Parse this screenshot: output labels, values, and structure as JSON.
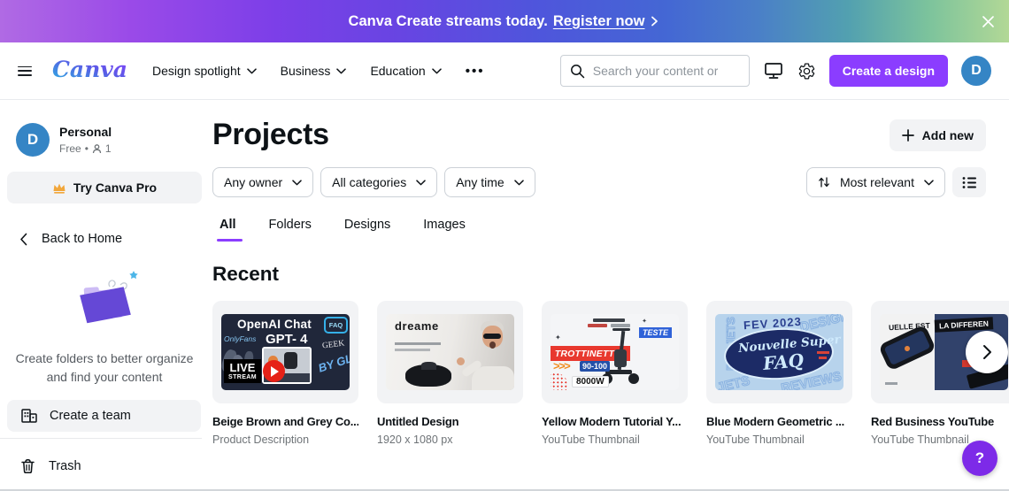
{
  "banner": {
    "message": "Canva Create streams today.",
    "cta": "Register now"
  },
  "header": {
    "logo": "Canva",
    "nav": [
      {
        "label": "Design spotlight"
      },
      {
        "label": "Business"
      },
      {
        "label": "Education"
      }
    ],
    "more": "•••",
    "search_placeholder": "Search your content or ",
    "create_button": "Create a design",
    "avatar_initial": "D"
  },
  "sidebar": {
    "avatar_initial": "D",
    "team_name": "Personal",
    "plan": "Free",
    "separator": "•",
    "members_count": "1",
    "try_pro": "Try Canva Pro",
    "back_home": "Back to Home",
    "empty_line1": "Create folders to better organize",
    "empty_line2": "and find your content",
    "create_team": "Create a team",
    "trash": "Trash"
  },
  "main": {
    "title": "Projects",
    "add_new": "Add new",
    "filters": [
      {
        "label": "Any owner"
      },
      {
        "label": "All categories"
      },
      {
        "label": "Any time"
      }
    ],
    "sort": "Most relevant",
    "tabs": [
      {
        "label": "All"
      },
      {
        "label": "Folders"
      },
      {
        "label": "Designs"
      },
      {
        "label": "Images"
      }
    ],
    "section_title": "Recent",
    "cards": [
      {
        "title": "Beige Brown and Grey Co...",
        "subtitle": "Product Description",
        "thumb": {
          "line1": "OpenAI Chat",
          "line2": "GPT- 4",
          "brand": "OnlyFans",
          "faq": "FAQ",
          "geek": "GEEK",
          "bygl": "BY GL",
          "live": "LIVE",
          "stream": "STREAM"
        }
      },
      {
        "title": "Untitled Design",
        "subtitle": "1920 x 1080 px",
        "thumb": {
          "brand": "dreame"
        }
      },
      {
        "title": "Yellow Modern Tutorial Y...",
        "subtitle": "YouTube Thumbnail",
        "thumb": {
          "banner": "TROTTINETTE",
          "teste": "TESTE",
          "arrows": ">>>",
          "speed": "90-100",
          "watt": "8000W",
          "sparkle": "✦"
        }
      },
      {
        "title": "Blue Modern Geometric ...",
        "subtitle": "YouTube Thumbnail",
        "thumb": {
          "fev": "FEV 2023",
          "script1": "Nouvelle Super",
          "script2": "FAQ",
          "bg1": "PROJETS",
          "bg2": "DESIGN",
          "bg3": "REVIEWS",
          "bg4": "JETS"
        }
      },
      {
        "title": "Red Business YouTube",
        "subtitle": "YouTube Thumbnail",
        "thumb": {
          "text_left": "UELLE EST",
          "text_right": "LA DIFFEREN"
        }
      }
    ]
  },
  "help": "?"
}
